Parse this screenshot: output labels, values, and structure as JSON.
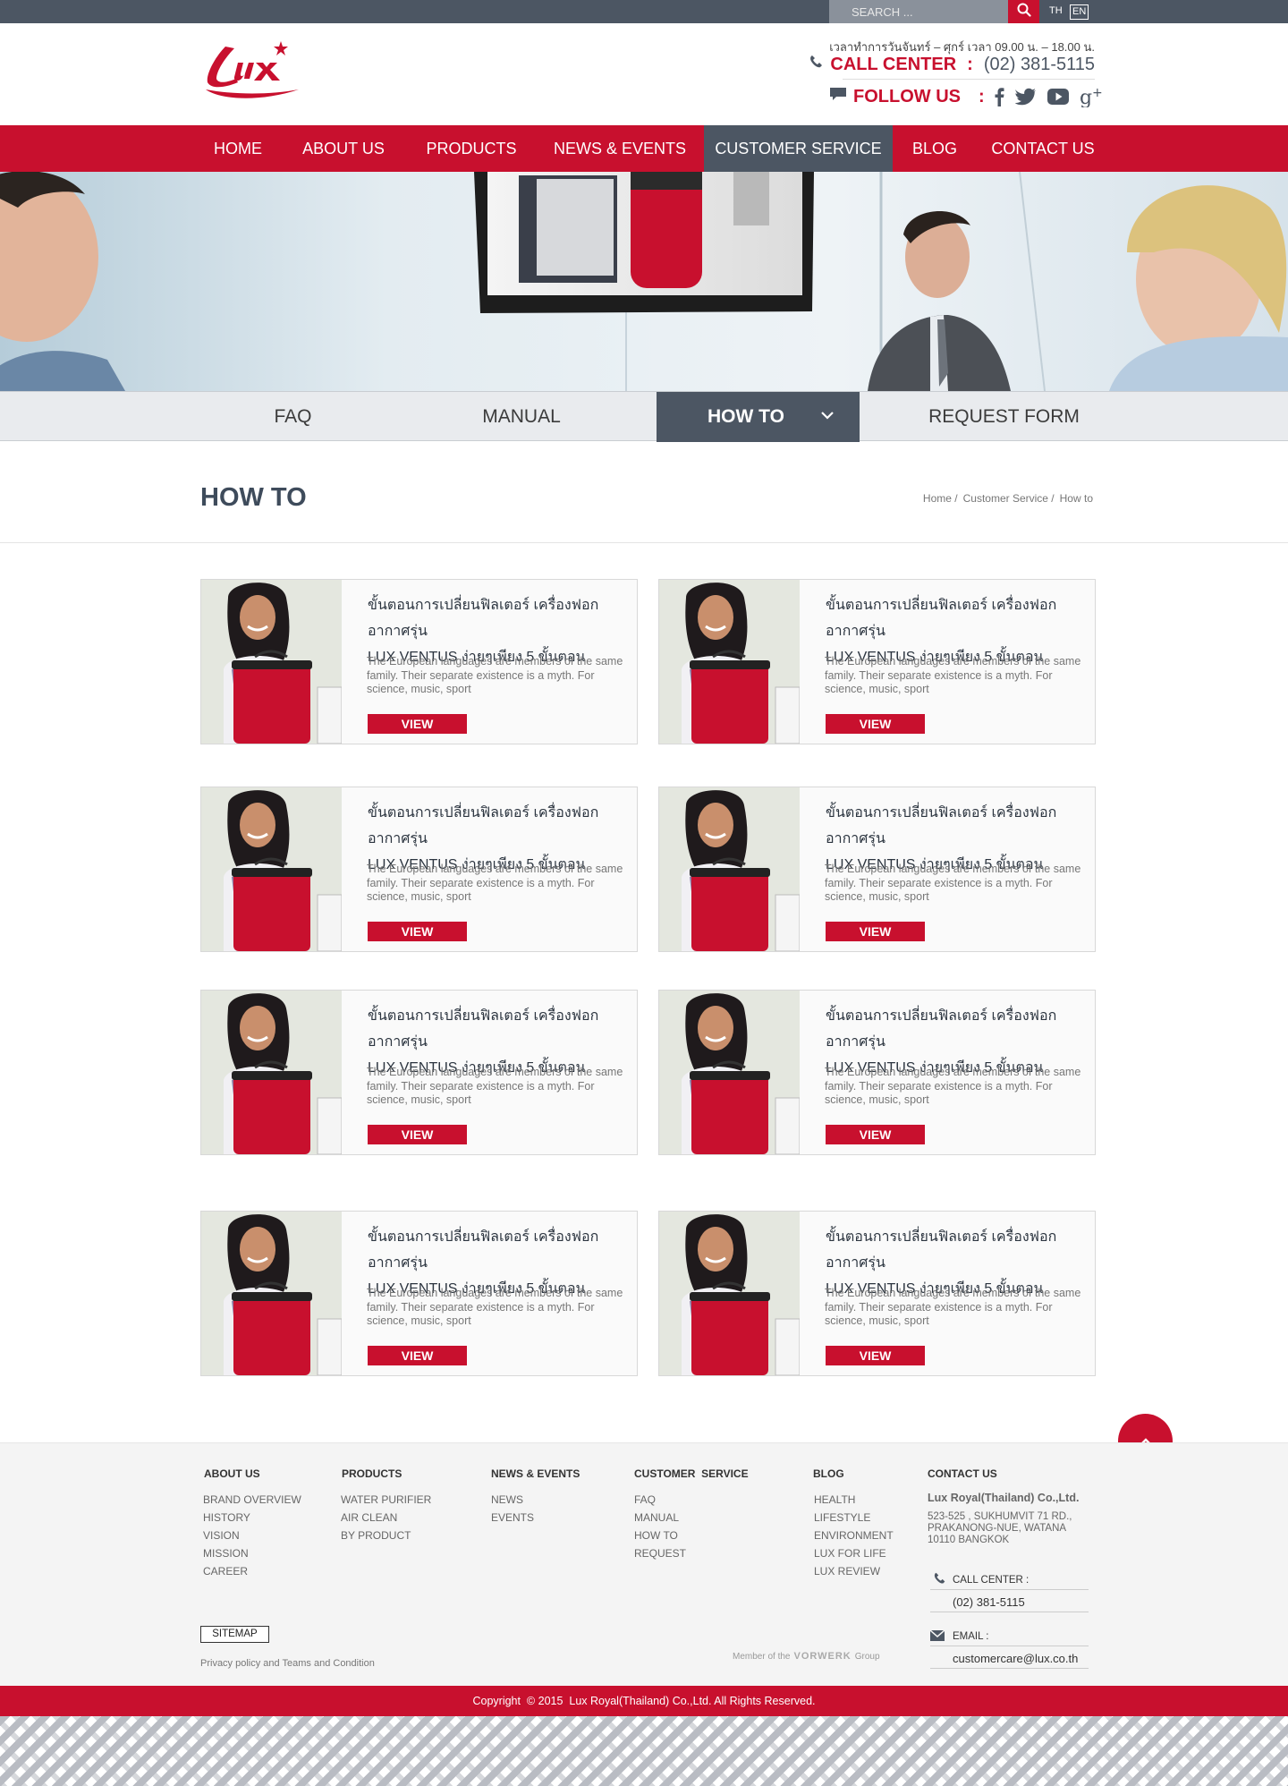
{
  "topbar": {
    "search_placeholder": "SEARCH ...",
    "lang_th": "TH",
    "lang_en": "EN"
  },
  "header": {
    "hours": "เวลาทำการวันจันทร์ – ศุกร์ เวลา 09.00 น. – 18.00 น.",
    "call_center_label": "CALL CENTER",
    "call_center_colon": ":",
    "call_center_number": "(02) 381-5115",
    "follow_label": "FOLLOW US",
    "follow_colon": ":"
  },
  "nav": [
    {
      "label": "HOME"
    },
    {
      "label": "ABOUT US"
    },
    {
      "label": "PRODUCTS"
    },
    {
      "label": "NEWS & EVENTS"
    },
    {
      "label": "CUSTOMER SERVICE",
      "active": true
    },
    {
      "label": "BLOG"
    },
    {
      "label": "CONTACT US"
    }
  ],
  "subtabs": [
    {
      "label": "FAQ"
    },
    {
      "label": "MANUAL"
    },
    {
      "label": "HOW TO",
      "active": true
    },
    {
      "label": "REQUEST FORM"
    }
  ],
  "page": {
    "title": "HOW TO",
    "breadcrumb": [
      "Home /",
      "Customer Service /",
      "How to"
    ]
  },
  "cards": [
    {
      "title_line1": "ขั้นตอนการเปลี่ยนฟิลเตอร์ เครื่องฟอกอากาศรุ่น",
      "title_line2": "LUX VENTUS ง่ายๆเพียง 5 ขั้นตอน",
      "desc": "The European languages are members of the same family. Their separate existence is a myth. For science, music, sport",
      "button": "VIEW"
    },
    {
      "title_line1": "ขั้นตอนการเปลี่ยนฟิลเตอร์ เครื่องฟอกอากาศรุ่น",
      "title_line2": "LUX VENTUS ง่ายๆเพียง 5 ขั้นตอน",
      "desc": "The European languages are members of the same family. Their separate existence is a myth. For science, music, sport",
      "button": "VIEW"
    },
    {
      "title_line1": "ขั้นตอนการเปลี่ยนฟิลเตอร์ เครื่องฟอกอากาศรุ่น",
      "title_line2": "LUX VENTUS ง่ายๆเพียง 5 ขั้นตอน",
      "desc": "The European languages are members of the same family. Their separate existence is a myth. For science, music, sport",
      "button": "VIEW"
    },
    {
      "title_line1": "ขั้นตอนการเปลี่ยนฟิลเตอร์ เครื่องฟอกอากาศรุ่น",
      "title_line2": "LUX VENTUS ง่ายๆเพียง 5 ขั้นตอน",
      "desc": "The European languages are members of the same family. Their separate existence is a myth. For science, music, sport",
      "button": "VIEW"
    },
    {
      "title_line1": "ขั้นตอนการเปลี่ยนฟิลเตอร์ เครื่องฟอกอากาศรุ่น",
      "title_line2": "LUX VENTUS ง่ายๆเพียง 5 ขั้นตอน",
      "desc": "The European languages are members of the same family. Their separate existence is a myth. For science, music, sport",
      "button": "VIEW"
    },
    {
      "title_line1": "ขั้นตอนการเปลี่ยนฟิลเตอร์ เครื่องฟอกอากาศรุ่น",
      "title_line2": "LUX VENTUS ง่ายๆเพียง 5 ขั้นตอน",
      "desc": "The European languages are members of the same family. Their separate existence is a myth. For science, music, sport",
      "button": "VIEW"
    },
    {
      "title_line1": "ขั้นตอนการเปลี่ยนฟิลเตอร์ เครื่องฟอกอากาศรุ่น",
      "title_line2": "LUX VENTUS ง่ายๆเพียง 5 ขั้นตอน",
      "desc": "The European languages are members of the same family. Their separate existence is a myth. For science, music, sport",
      "button": "VIEW"
    },
    {
      "title_line1": "ขั้นตอนการเปลี่ยนฟิลเตอร์ เครื่องฟอกอากาศรุ่น",
      "title_line2": "LUX VENTUS ง่ายๆเพียง 5 ขั้นตอน",
      "desc": "The European languages are members of the same family. Their separate existence is a myth. For science, music, sport",
      "button": "VIEW"
    }
  ],
  "footer": {
    "about": {
      "head": "ABOUT US",
      "links": [
        "BRAND OVERVIEW",
        "HISTORY",
        "VISION",
        "MISSION",
        "CAREER"
      ]
    },
    "products": {
      "head": "PRODUCTS",
      "links": [
        "WATER PURIFIER",
        "AIR CLEAN",
        "BY PRODUCT"
      ]
    },
    "news": {
      "head": "NEWS & EVENTS",
      "links": [
        "NEWS",
        "EVENTS"
      ]
    },
    "service": {
      "head": "CUSTOMER  SERVICE",
      "links": [
        "FAQ",
        "MANUAL",
        "HOW TO",
        "REQUEST"
      ]
    },
    "blog": {
      "head": "BLOG",
      "links": [
        "HEALTH",
        "LIFESTYLE",
        "ENVIRONMENT",
        "LUX FOR LIFE",
        "LUX REVIEW"
      ]
    },
    "contact": {
      "head": "CONTACT US",
      "company": "Lux Royal(Thailand) Co.,Ltd.",
      "address_1": "523-525 , SUKHUMVIT 71 RD.,",
      "address_2": "PRAKANONG-NUE, WATANA",
      "address_3": "10110 BANGKOK",
      "call_label": "CALL CENTER :",
      "call_value": "(02) 381-5115",
      "email_label": "EMAIL :",
      "email_value": "customercare@lux.co.th"
    },
    "sitemap": "SITEMAP",
    "privacy": "Privacy policy and Teams and Condition",
    "member_prefix": "Member of the",
    "member_brand": "VORWERK",
    "member_suffix": "Group",
    "copyright": "Copyright  © 2015  Lux Royal(Thailand) Co.,Ltd. All Rights Reserved."
  },
  "colors": {
    "brand_red": "#c8102e",
    "slate": "#4c5663",
    "light_gray": "#e9ebee"
  },
  "icons": [
    "search-icon",
    "phone-icon",
    "chat-bubble-icon",
    "facebook-icon",
    "twitter-icon",
    "youtube-icon",
    "google-plus-icon",
    "chevron-down-icon",
    "chevron-up-icon",
    "email-icon"
  ]
}
